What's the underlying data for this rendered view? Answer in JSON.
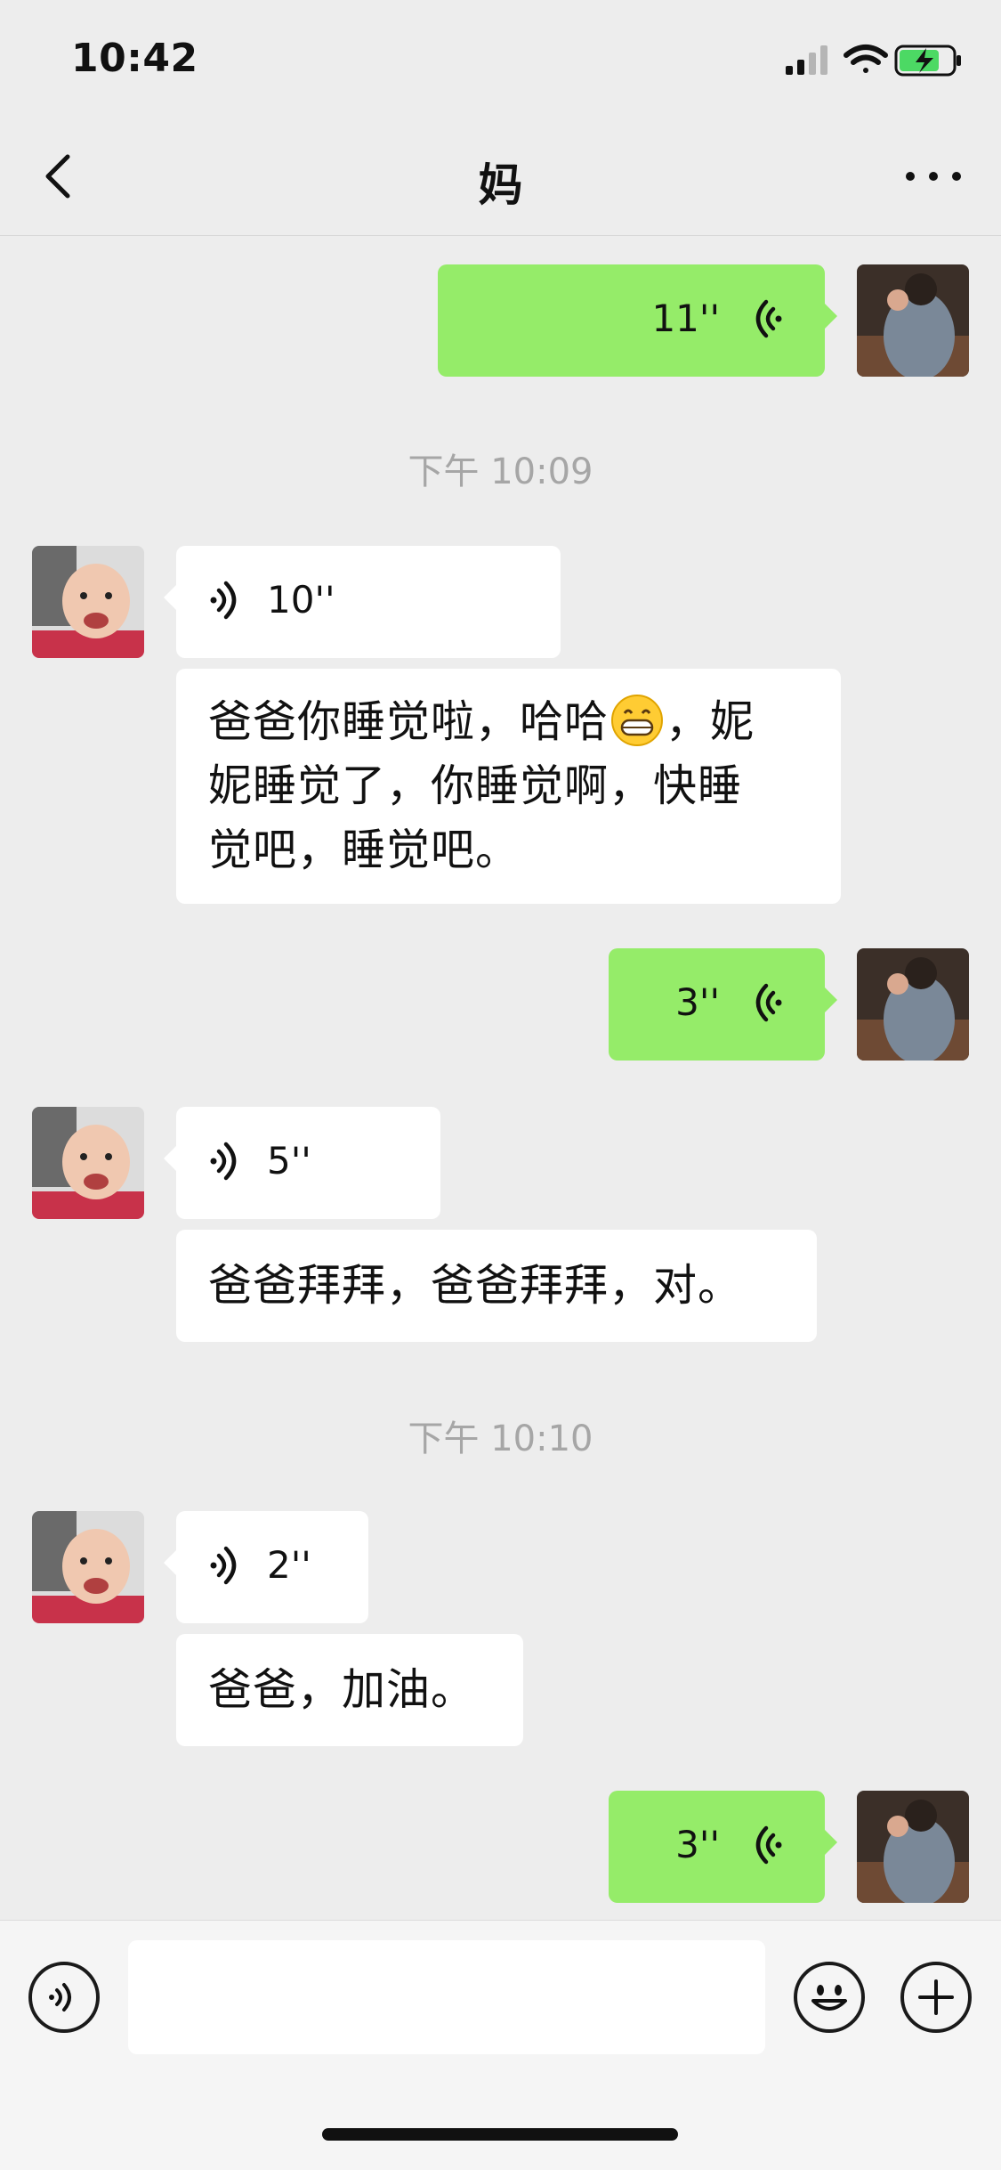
{
  "status": {
    "time": "10:42"
  },
  "nav": {
    "title": "妈"
  },
  "messages": [
    {
      "side": "out",
      "kind": "voice",
      "duration": "11''"
    },
    {
      "kind": "time",
      "text": "下午 10:09"
    },
    {
      "side": "in",
      "kind": "voice",
      "duration": "10''"
    },
    {
      "side": "in",
      "kind": "text",
      "line1": "爸爸你睡觉啦，哈哈",
      "line1b": "，妮",
      "line2": "妮睡觉了，你睡觉啊，快睡",
      "line3": "觉吧，睡觉吧。",
      "emoji": "grinning-emoji"
    },
    {
      "side": "out",
      "kind": "voice",
      "duration": "3''"
    },
    {
      "side": "in",
      "kind": "voice",
      "duration": "5''"
    },
    {
      "side": "in",
      "kind": "text",
      "text": "爸爸拜拜，爸爸拜拜，对。"
    },
    {
      "kind": "time",
      "text": "下午 10:10"
    },
    {
      "side": "in",
      "kind": "voice",
      "duration": "2''"
    },
    {
      "side": "in",
      "kind": "text",
      "text": "爸爸，加油。"
    },
    {
      "side": "out",
      "kind": "voice",
      "duration": "3''"
    }
  ],
  "input": {
    "value": "",
    "placeholder": ""
  },
  "colors": {
    "outgoing_bubble": "#95ec69",
    "incoming_bubble": "#ffffff",
    "background": "#ededed",
    "battery": "#4cd964"
  },
  "icons": [
    "signal-icon",
    "wifi-icon",
    "battery-icon",
    "back-chevron-icon",
    "more-icon",
    "voice-wave-icon",
    "emoji-icon",
    "plus-icon"
  ]
}
